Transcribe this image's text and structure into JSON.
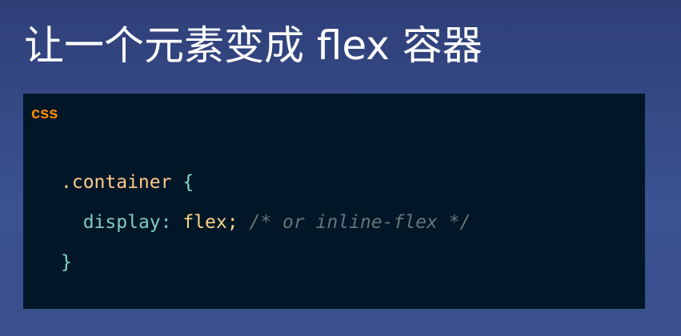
{
  "title": "让一个元素变成 flex 容器",
  "code": {
    "language": "css",
    "selector": ".container",
    "open_brace": "{",
    "property": "display",
    "colon": ":",
    "value": "flex",
    "semicolon": ";",
    "comment": "/* or inline-flex */",
    "close_brace": "}"
  }
}
